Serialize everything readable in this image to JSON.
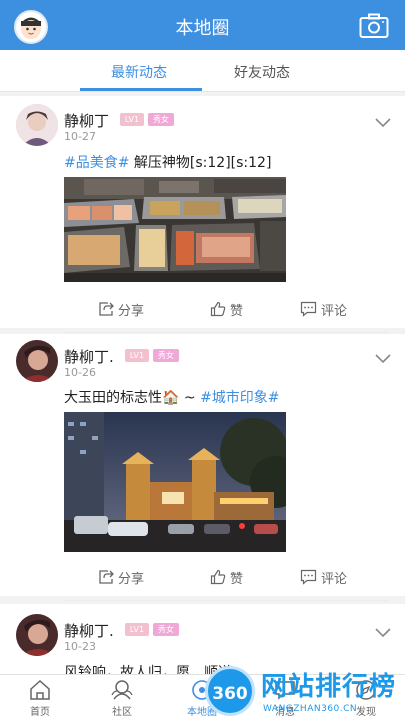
{
  "header": {
    "title": "本地圈",
    "avatar_icon": "cartoon-avatar-icon",
    "camera_icon": "camera-icon"
  },
  "tabs": [
    {
      "label": "最新动态",
      "active": true
    },
    {
      "label": "好友动态",
      "active": false
    }
  ],
  "posts": [
    {
      "username": "静柳丁",
      "level_badge": "LV1",
      "gender_badge": "秀女",
      "date": "10-27",
      "content_tag": "#品美食#",
      "content_text": " 解压神物[s:12][s:12]",
      "image": "food-display-photo",
      "share_label": "分享",
      "like_label": "赞",
      "comment_label": "评论"
    },
    {
      "username": "静柳丁.",
      "level_badge": "LV1",
      "gender_badge": "秀女",
      "date": "10-26",
      "content_text": "大玉田的标志性",
      "content_emoji": "🏠",
      "content_sep": " ~ ",
      "content_tag": "#城市印象#",
      "image": "night-city-gate-photo",
      "share_label": "分享",
      "like_label": "赞",
      "comment_label": "评论"
    },
    {
      "username": "静柳丁.",
      "level_badge": "LV1",
      "gender_badge": "秀女",
      "date": "10-23",
      "content_text": "风铃响，故人归，愿…顺遂"
    }
  ],
  "bottom_nav": [
    {
      "label": "首页",
      "icon": "home-icon",
      "active": false
    },
    {
      "label": "社区",
      "icon": "community-icon",
      "active": false
    },
    {
      "label": "本地圈",
      "icon": "local-circle-icon",
      "active": true
    },
    {
      "label": "消息",
      "icon": "message-icon",
      "active": false
    },
    {
      "label": "发现",
      "icon": "discover-icon",
      "active": false
    }
  ],
  "watermark": {
    "logo": "360",
    "title": "网站排行榜",
    "subtitle": "WANGZHAN360.CN"
  },
  "colors": {
    "primary": "#3d8fe0",
    "badge_level": "#f2c0cf",
    "badge_gender": "#f0a8d6"
  }
}
